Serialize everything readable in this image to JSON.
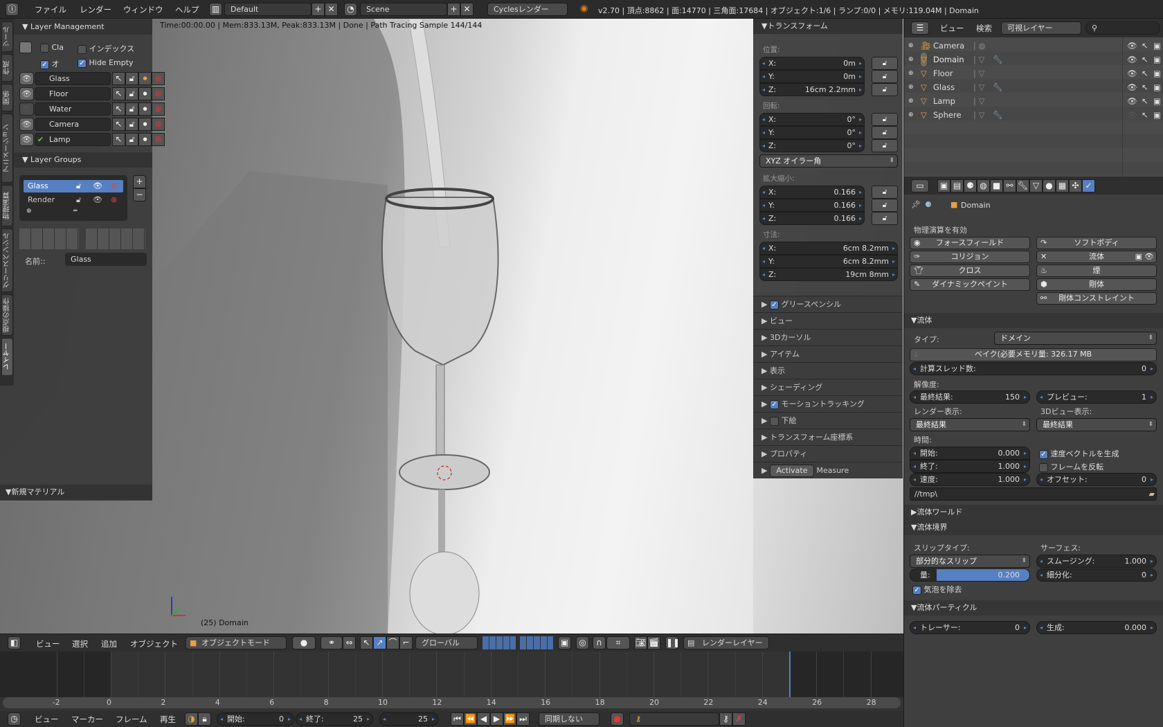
{
  "topbar": {
    "menus": [
      "ファイル",
      "レンダー",
      "ウィンドウ",
      "ヘルプ"
    ],
    "layout": "Default",
    "scene": "Scene",
    "engine": "Cyclesレンダー",
    "stats": "v2.70 | 頂点:8862 | 面:14770 | 三角面:17684 | オブジェクト:1/6 | ランプ:0/0 | メモリ:119.04M | Domain"
  },
  "tool_tabs": [
    "ツール",
    "作成",
    "関係",
    "アニメーション",
    "物理演算",
    "グリースペンシル",
    "視点の操作",
    "レイヤー"
  ],
  "layer_mgmt": {
    "title": "Layer Management",
    "opt1": "Cla",
    "opt2": "インデックス",
    "opt3": "オ",
    "opt4": "Hide Empty",
    "opt1_checked": false,
    "opt2_checked": false,
    "opt3_checked": true,
    "opt4_checked": true,
    "layers": [
      {
        "name": "Glass",
        "visible": true
      },
      {
        "name": "Floor",
        "visible": true
      },
      {
        "name": "Water",
        "visible": false
      },
      {
        "name": "Camera",
        "visible": true
      },
      {
        "name": "Lamp",
        "visible": true,
        "active": true
      }
    ]
  },
  "layer_groups": {
    "title": "Layer Groups",
    "items": [
      "Glass",
      "Render"
    ],
    "selected": "Glass",
    "name_label": "名前::",
    "name_value": "Glass"
  },
  "new_material": {
    "title": "新規マテリアル"
  },
  "viewport": {
    "render_info": "Time:00:00.00 | Mem:833.13M, Peak:833.13M | Done | Path Tracing Sample 144/144",
    "object_label": "(25) Domain"
  },
  "transform": {
    "title": "トランスフォーム",
    "location_label": "位置:",
    "location": {
      "x": "0m",
      "y": "0m",
      "z": "16cm 2.2mm"
    },
    "rotation_label": "回転:",
    "rotation": {
      "x": "0°",
      "y": "0°",
      "z": "0°"
    },
    "rotation_mode": "XYZ オイラー角",
    "scale_label": "拡大縮小:",
    "scale": {
      "x": "0.166",
      "y": "0.166",
      "z": "0.166"
    },
    "dimensions_label": "寸法:",
    "dimensions": {
      "x": "6cm 8.2mm",
      "y": "6cm 8.2mm",
      "z": "19cm 8mm"
    },
    "axis": {
      "x": "X:",
      "y": "Y:",
      "z": "Z:"
    }
  },
  "npanels": [
    {
      "label": "グリースペンシル",
      "checkbox": true
    },
    {
      "label": "ビュー"
    },
    {
      "label": "3Dカーソル"
    },
    {
      "label": "アイテム"
    },
    {
      "label": "表示"
    },
    {
      "label": "シェーディング"
    },
    {
      "label": "モーショントラッキング",
      "checkbox": true
    },
    {
      "label": "下絵",
      "checkbox": false
    },
    {
      "label": "トランスフォーム座標系"
    },
    {
      "label": "プロパティ"
    }
  ],
  "measure": {
    "button": "Activate",
    "label": "Measure"
  },
  "header3d": {
    "menus": [
      "ビュー",
      "選択",
      "追加",
      "オブジェクト"
    ],
    "mode": "オブジェクトモード",
    "orientation": "グローバル",
    "render_layer": "レンダーレイヤー"
  },
  "timeline": {
    "ticks": [
      "-2",
      "0",
      "2",
      "4",
      "6",
      "8",
      "10",
      "12",
      "14",
      "16",
      "18",
      "20",
      "22",
      "24",
      "26",
      "28"
    ],
    "current_frame": 25,
    "start": 0,
    "end": 25,
    "menus": [
      "ビュー",
      "マーカー",
      "フレーム",
      "再生"
    ],
    "start_label": "開始:",
    "start_value": "0",
    "end_label": "終了:",
    "end_value": "25",
    "frame_value": "25",
    "sync": "同期しない"
  },
  "outliner": {
    "menus": [
      "ビュー",
      "検索"
    ],
    "filter": "可視レイヤー",
    "items": [
      {
        "name": "Camera",
        "visible": true
      },
      {
        "name": "Domain",
        "visible": true,
        "active": true
      },
      {
        "name": "Floor",
        "visible": true
      },
      {
        "name": "Glass",
        "visible": true
      },
      {
        "name": "Lamp",
        "visible": true
      },
      {
        "name": "Sphere",
        "visible": false
      }
    ]
  },
  "properties": {
    "context": "Domain",
    "physics_title": "物理演算を有効",
    "left_buttons": [
      "フォースフィールド",
      "コリジョン",
      "クロス",
      "ダイナミックペイント"
    ],
    "right_buttons": [
      "ソフトボディ",
      "流体",
      "煙",
      "剛体",
      "剛体コンストレイント"
    ],
    "fluid": {
      "title": "流体",
      "type_label": "タイプ:",
      "type": "ドメイン",
      "bake": "ベイク(必要メモリ量: 326.17 MB",
      "threads_label": "計算スレッド数:",
      "threads": "0",
      "resolution_label": "解像度:",
      "final_label": "最終結果:",
      "final": "150",
      "preview_label": "プレビュー:",
      "preview": "1",
      "render_display_label": "レンダー表示:",
      "render_display": "最終結果",
      "view_display_label": "3Dビュー表示:",
      "view_display": "最終結果",
      "time_label": "時間:",
      "start_label": "開始:",
      "start": "0.000",
      "end_label": "終了:",
      "end": "1.000",
      "speed_label": "速度:",
      "speed": "1.000",
      "gen_speed_vectors": "速度ベクトルを生成",
      "gen_speed_vectors_checked": true,
      "reverse_frames": "フレームを反転",
      "reverse_frames_checked": false,
      "offset_label": "オフセット:",
      "offset": "0",
      "path": "//tmp\\"
    },
    "fluid_world": {
      "title": "流体ワールド"
    },
    "fluid_boundary": {
      "title": "流体境界",
      "slip_label": "スリップタイプ:",
      "slip": "部分的なスリップ",
      "amount_label": "量:",
      "amount": "0.200",
      "amount_fraction": 0.2,
      "surface_label": "サーフェス:",
      "smoothing_label": "スムージング:",
      "smoothing": "1.000",
      "subdiv_label": "細分化:",
      "subdiv": "0",
      "remove_air": "気泡を除去",
      "remove_air_checked": true
    },
    "fluid_particles": {
      "title": "流体パーティクル",
      "tracer_label": "トレーサー:",
      "tracer": "0",
      "generate_label": "生成:",
      "generate": "0.000"
    }
  },
  "colors": {
    "accent": "#5680c2",
    "frame_marker": "#5680c2"
  }
}
